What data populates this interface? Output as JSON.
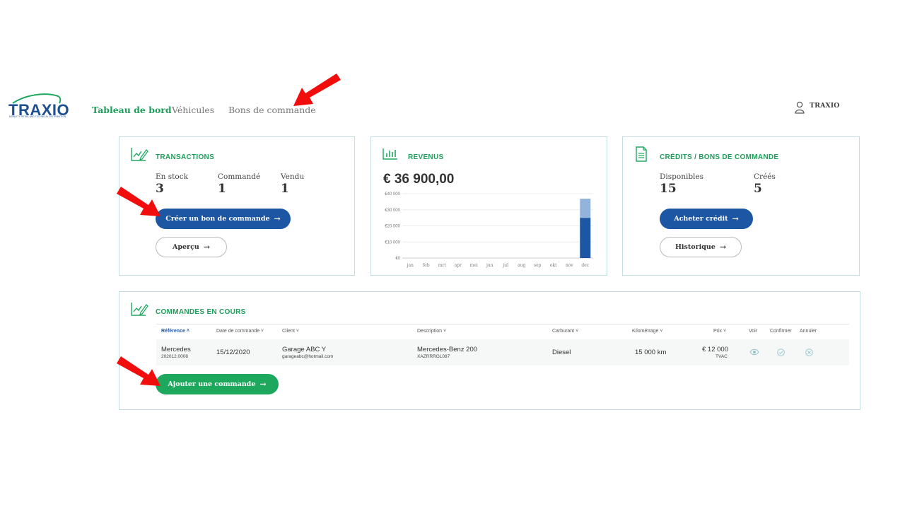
{
  "brand": {
    "name": "TRAXIO",
    "tagline": "MOBILITY RETAIL AND TECHNICAL DISTRIBUTION"
  },
  "nav": {
    "dashboard": "Tableau de bord",
    "vehicles": "Véhicules",
    "orders": "Bons de commande"
  },
  "user": {
    "name": "TRAXIO"
  },
  "transactions": {
    "title": "TRANSACTIONS",
    "stats": [
      {
        "label": "En stock",
        "value": "3"
      },
      {
        "label": "Commandé",
        "value": "1"
      },
      {
        "label": "Vendu",
        "value": "1"
      }
    ],
    "create_button": "Créer un bon de commande",
    "overview_button": "Aperçu"
  },
  "revenue": {
    "title": "REVENUS",
    "amount": "€ 36 900,00",
    "chart_data": {
      "type": "bar",
      "categories": [
        "jan",
        "feb",
        "mrt",
        "apr",
        "mei",
        "jun",
        "jul",
        "aug",
        "sep",
        "okt",
        "nov",
        "dec"
      ],
      "series": [
        {
          "values": [
            0,
            0,
            0,
            0,
            0,
            0,
            0,
            0,
            0,
            0,
            0,
            25000
          ]
        },
        {
          "values": [
            0,
            0,
            0,
            0,
            0,
            0,
            0,
            0,
            0,
            0,
            0,
            11900
          ]
        }
      ],
      "y_ticks": [
        "€0",
        "€10 000",
        "€20 000",
        "€30 000",
        "€40 000"
      ],
      "ylim": [
        0,
        40000
      ],
      "stacked": true,
      "grid": true,
      "colors": [
        "#1d56a3",
        "#92b3da"
      ]
    }
  },
  "credits": {
    "title": "CRÉDITS / BONS DE COMMANDE",
    "stats": [
      {
        "label": "Disponibles",
        "value": "15"
      },
      {
        "label": "Créés",
        "value": "5"
      }
    ],
    "buy_button": "Acheter crédit",
    "history_button": "Historique"
  },
  "orders": {
    "title": "COMMANDES EN COURS",
    "columns": {
      "reference": "Référence",
      "date": "Date de commande",
      "client": "Client",
      "description": "Description",
      "fuel": "Carburant",
      "mileage": "Kilométrage",
      "price": "Prix",
      "view": "Voir",
      "confirm": "Confirmer",
      "cancel": "Annuler"
    },
    "rows": [
      {
        "reference": "Mercedes",
        "reference_id": "202012.0008",
        "date": "15/12/2020",
        "client": "Garage ABC Y",
        "client_email": "garageabc@hotmail.com",
        "description": "Mercedes-Benz 200",
        "description_id": "XAZRRRGL087",
        "fuel": "Diesel",
        "mileage": "15 000 km",
        "price": "€ 12 000",
        "price_note": "TVAC"
      }
    ],
    "add_button": "Ajouter une commande"
  },
  "icons": {
    "user": "user-icon",
    "transactions": "chart-edit-icon",
    "revenue": "bar-chart-icon",
    "credits": "document-icon",
    "orders": "chart-edit-icon",
    "view": "eye-icon",
    "confirm": "check-circle-icon",
    "cancel": "x-circle-icon",
    "annotation": "red-arrow-icon"
  },
  "colors": {
    "accent_green": "#1ea85e",
    "primary_blue": "#1d56a3",
    "card_border": "#c4dde0",
    "annotation_red": "#f20d0d"
  }
}
